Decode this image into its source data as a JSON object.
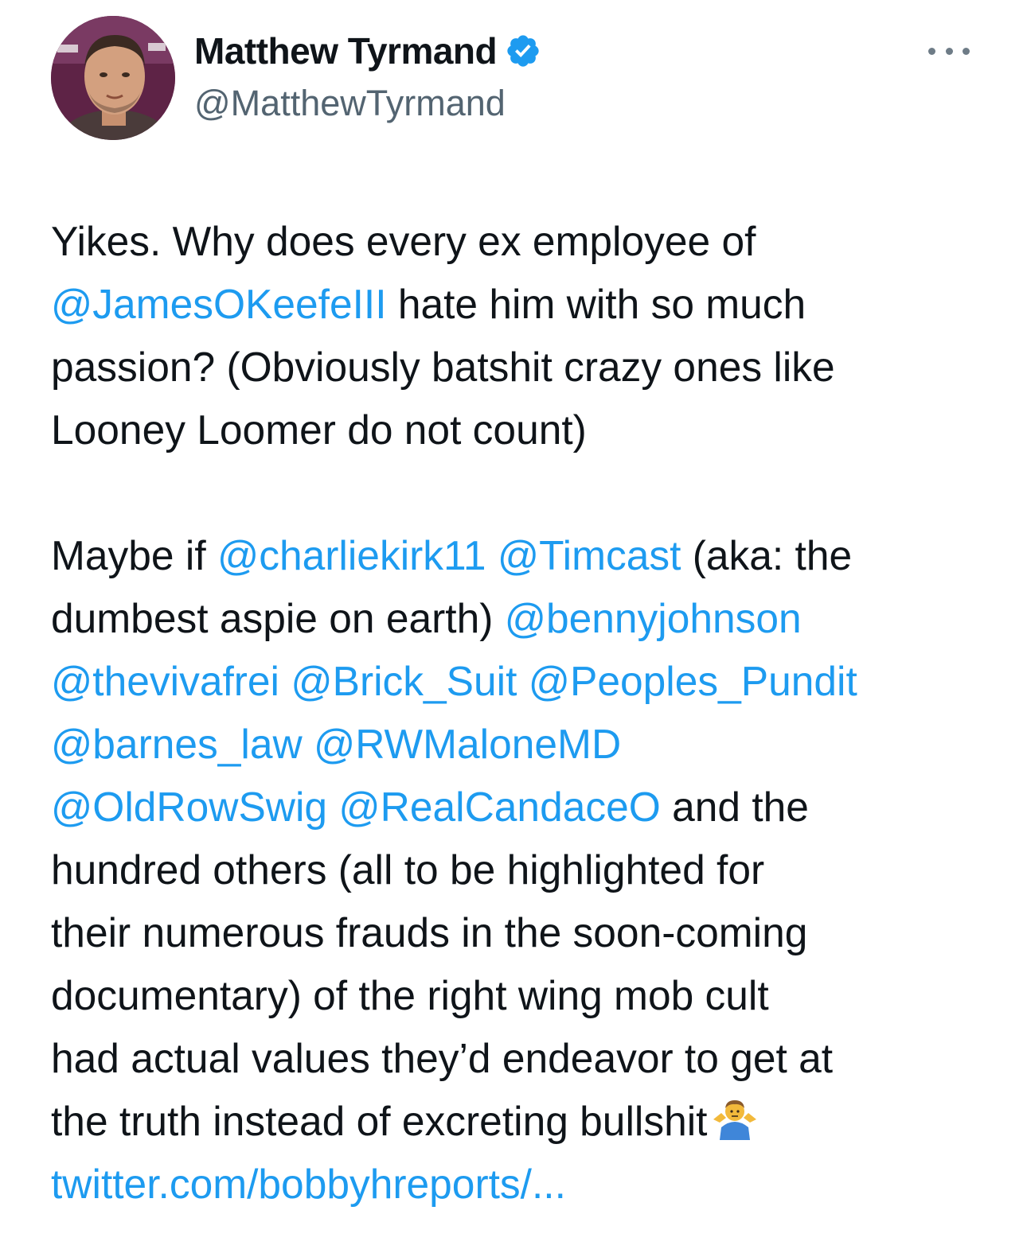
{
  "author": {
    "display_name": "Matthew Tyrmand",
    "handle": "@MatthewTyrmand",
    "verified": true,
    "avatar_icon": "profile-photo"
  },
  "menu": {
    "icon": "more-options-icon"
  },
  "tweet": {
    "paragraph1": {
      "l1": "Yikes. Why does every ex employee of",
      "l2_mention": "@JamesOKeefeIII",
      "l2_rest": " hate him with so much",
      "l3": "passion? (Obviously batshit crazy ones like",
      "l4": "Looney Loomer do not count)"
    },
    "paragraph2": {
      "l1_pre": "Maybe if ",
      "l1_m1": "@charliekirk11",
      "l1_sp": " ",
      "l1_m2": "@Timcast",
      "l1_post": " (aka: the",
      "l2_pre": "dumbest aspie on earth) ",
      "l2_m": "@bennyjohnson",
      "l3_m1": "@thevivafrei",
      "l3_m2": "@Brick_Suit",
      "l3_m3": "@Peoples_Pundit",
      "l4_m1": "@barnes_law",
      "l4_m2": "@RWMaloneMD",
      "l5_m1": "@OldRowSwig",
      "l5_m2": "@RealCandaceO",
      "l5_post": " and the",
      "l6": "hundred others (all to be highlighted for",
      "l7": "their numerous frauds in the soon-coming",
      "l8": "documentary) of the right wing mob cult",
      "l9": "had actual values they’d endeavor to get at",
      "l10": "the truth instead of excreting bullshit",
      "emoji_icon": "person-shrugging-emoji",
      "link": "twitter.com/bobbyhreports/..."
    }
  },
  "colors": {
    "text": "#0f1419",
    "secondary": "#536471",
    "link": "#1d9bf0"
  }
}
